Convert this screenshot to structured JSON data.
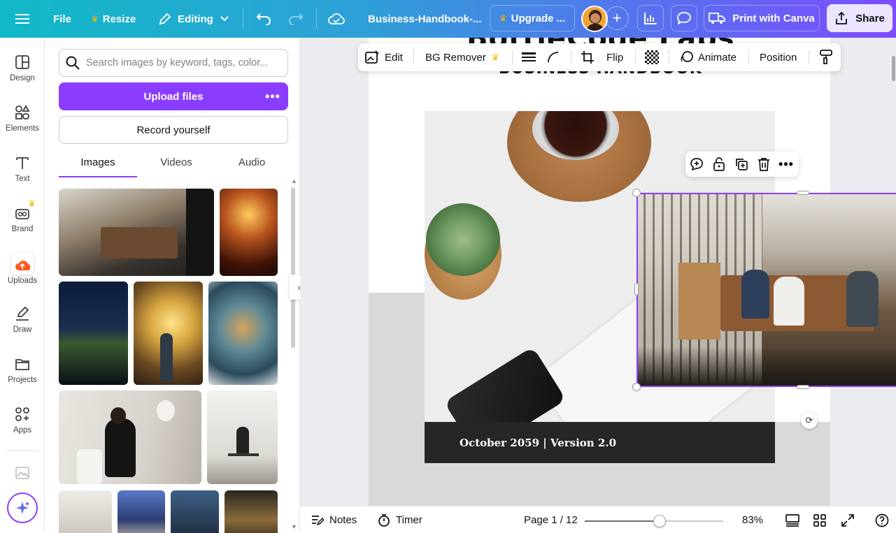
{
  "topbar": {
    "file": "File",
    "resize": "Resize",
    "editing": "Editing",
    "doc_title": "Business-Handbook-...",
    "upgrade": "Upgrade ...",
    "print": "Print with Canva",
    "share": "Share"
  },
  "rail": [
    {
      "label": "Design",
      "icon": "design-icon"
    },
    {
      "label": "Elements",
      "icon": "elements-icon"
    },
    {
      "label": "Text",
      "icon": "text-icon"
    },
    {
      "label": "Brand",
      "icon": "brand-icon"
    },
    {
      "label": "Uploads",
      "icon": "uploads-icon"
    },
    {
      "label": "Draw",
      "icon": "draw-icon"
    },
    {
      "label": "Projects",
      "icon": "projects-icon"
    },
    {
      "label": "Apps",
      "icon": "apps-icon"
    }
  ],
  "panel": {
    "search_placeholder": "Search images by keyword, tags, color...",
    "upload": "Upload files",
    "record": "Record yourself",
    "tabs": [
      "Images",
      "Videos",
      "Audio"
    ]
  },
  "toolbar": {
    "edit": "Edit",
    "bg_remover": "BG Remover",
    "flip": "Flip",
    "animate": "Animate",
    "position": "Position"
  },
  "page": {
    "title": "BottleCode Labs",
    "subtitle": "BUSINESS HANDBOOK",
    "banner": "October 2059 | Version 2.0"
  },
  "bottom": {
    "notes": "Notes",
    "timer": "Timer",
    "page_indicator": "Page 1 / 12",
    "zoom": "83%",
    "zoom_fraction": 0.54
  },
  "colors": {
    "accent": "#8b3dff",
    "crown": "#f7b500"
  }
}
